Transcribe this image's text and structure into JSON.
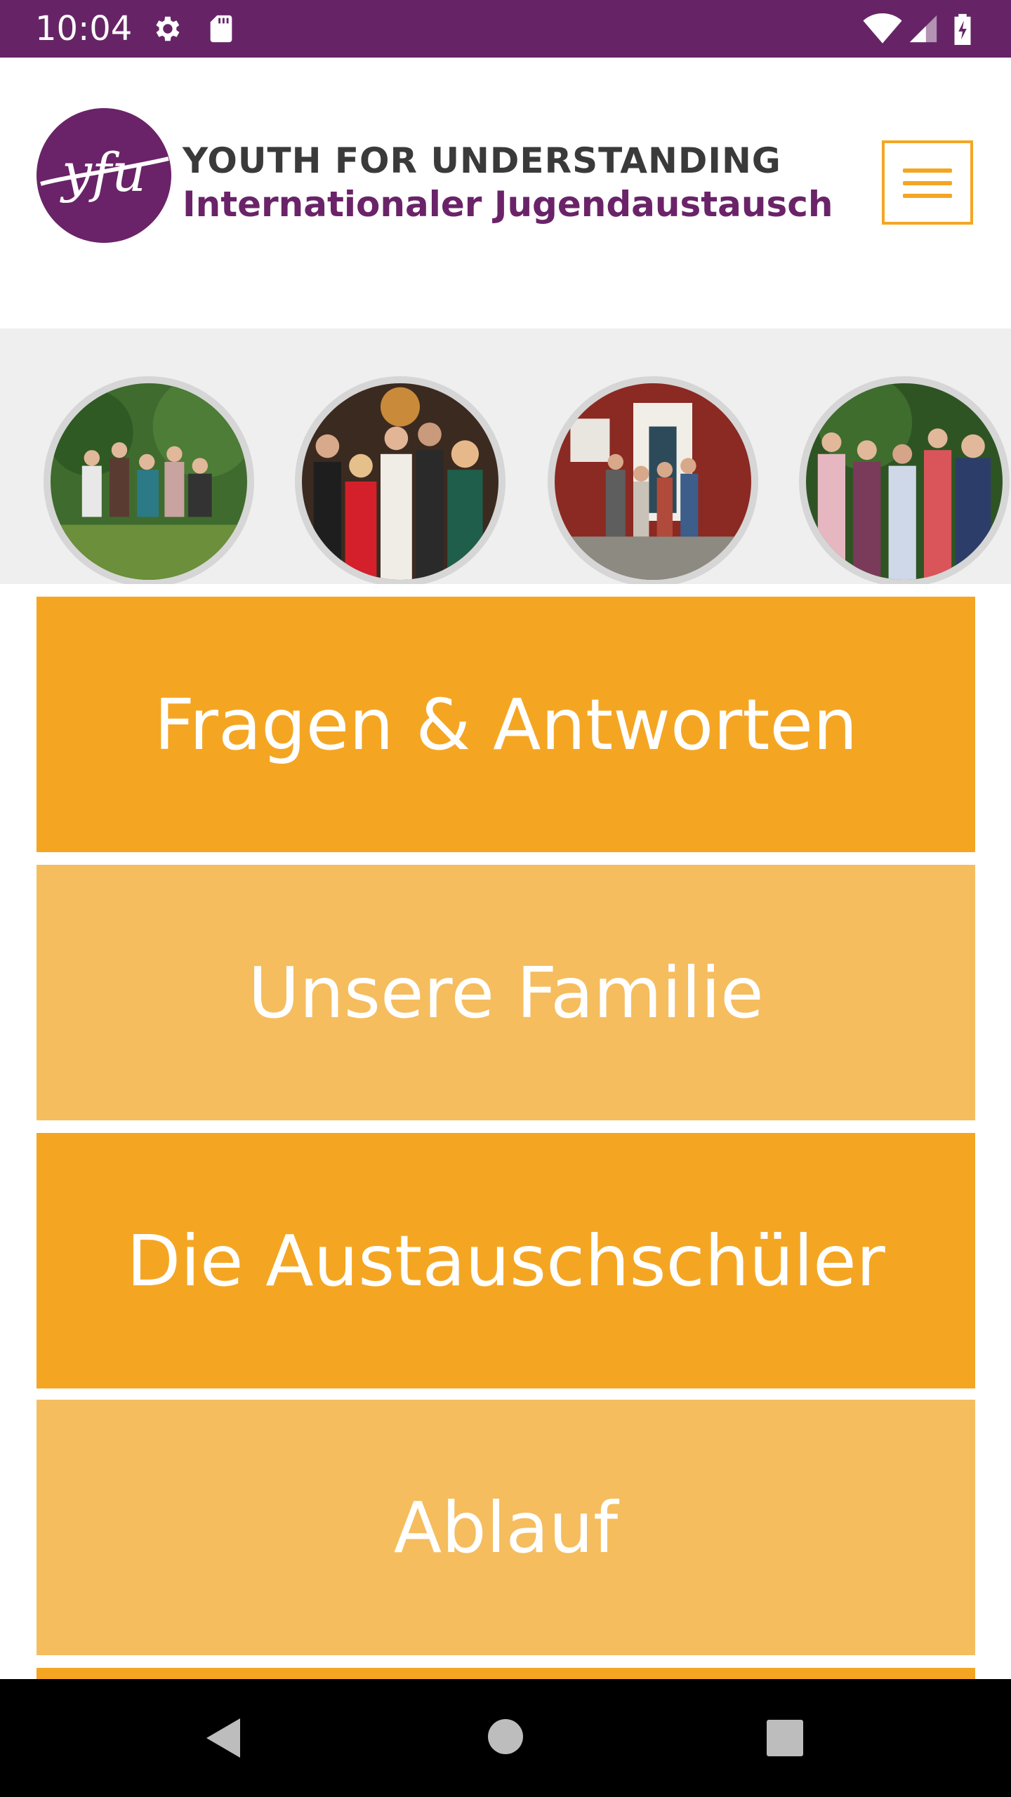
{
  "status_bar": {
    "time": "10:04",
    "icons": [
      "settings-icon",
      "sd-card-icon",
      "wifi-icon",
      "cell-signal-icon",
      "battery-charging-icon"
    ],
    "background": "#662466"
  },
  "header": {
    "logo_text": "yfu",
    "brand_title": "YOUTH FOR UNDERSTANDING",
    "brand_subtitle": "Internationaler Jugendaustausch",
    "menu_icon": "hamburger-menu-icon",
    "brand_color": "#6a2368",
    "accent_color": "#f4a623"
  },
  "gallery": {
    "photos": [
      "photo-group-garden",
      "photo-wedding-party",
      "photo-house-family",
      "photo-group-outdoor"
    ]
  },
  "menu_tiles": [
    {
      "label": "Fragen & Antworten",
      "color": "#f4a623"
    },
    {
      "label": "Unsere Familie",
      "color": "#f5bd5e"
    },
    {
      "label": "Die Austauschschüler",
      "color": "#f4a623"
    },
    {
      "label": "Ablauf",
      "color": "#f5bd5e"
    }
  ],
  "nav_bar": {
    "buttons": [
      "back-icon",
      "home-icon",
      "recents-icon"
    ]
  }
}
